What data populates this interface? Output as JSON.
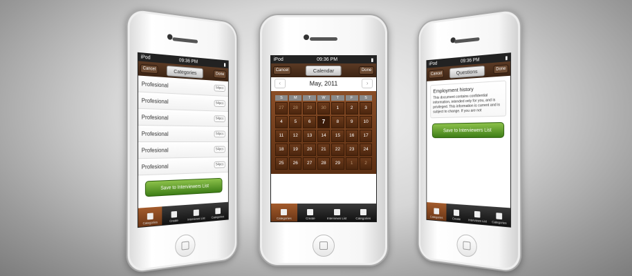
{
  "phones": [
    {
      "status": {
        "carrier": "iPod",
        "time": "09:36 PM"
      },
      "nav": {
        "left": "Cancel",
        "title": "Categories",
        "right": "Done"
      },
      "rows": [
        {
          "label": "Profesional",
          "badge": "54pcs"
        },
        {
          "label": "Profesional",
          "badge": "54pcs"
        },
        {
          "label": "Profesional",
          "badge": "54pcs"
        },
        {
          "label": "Profesional",
          "badge": "54pcs"
        },
        {
          "label": "Profesional",
          "badge": "54pcs"
        },
        {
          "label": "Profesional",
          "badge": "54pcs"
        }
      ],
      "save_label": "Save to Interviewers List",
      "tabs": [
        "Categories",
        "Create",
        "Interviews List",
        "Categories"
      ]
    },
    {
      "status": {
        "carrier": "iPod",
        "time": "09:36 PM"
      },
      "nav": {
        "left": "Cancel",
        "title": "Calendar",
        "right": "Done"
      },
      "month": "May, 2011",
      "weekdays": [
        "S",
        "M",
        "T",
        "W",
        "T",
        "F",
        "S"
      ],
      "days": [
        [
          "27",
          "out"
        ],
        [
          "28",
          "out"
        ],
        [
          "29",
          "out"
        ],
        [
          "30",
          "out"
        ],
        [
          "1",
          ""
        ],
        [
          "2",
          ""
        ],
        [
          "3",
          ""
        ],
        [
          "4",
          ""
        ],
        [
          "5",
          ""
        ],
        [
          "6",
          ""
        ],
        [
          "7",
          "today"
        ],
        [
          "8",
          ""
        ],
        [
          "9",
          ""
        ],
        [
          "10",
          ""
        ],
        [
          "11",
          ""
        ],
        [
          "12",
          ""
        ],
        [
          "13",
          ""
        ],
        [
          "14",
          ""
        ],
        [
          "15",
          ""
        ],
        [
          "16",
          ""
        ],
        [
          "17",
          ""
        ],
        [
          "18",
          ""
        ],
        [
          "19",
          ""
        ],
        [
          "20",
          ""
        ],
        [
          "21",
          ""
        ],
        [
          "22",
          ""
        ],
        [
          "23",
          ""
        ],
        [
          "24",
          ""
        ],
        [
          "25",
          ""
        ],
        [
          "26",
          ""
        ],
        [
          "27",
          ""
        ],
        [
          "28",
          ""
        ],
        [
          "29",
          ""
        ],
        [
          "1",
          "out"
        ],
        [
          "2",
          "out"
        ]
      ],
      "tabs": [
        "Categories",
        "Create",
        "Interviews List",
        "Categories"
      ]
    },
    {
      "status": {
        "carrier": "iPod",
        "time": "09:36 PM"
      },
      "nav": {
        "left": "Cancel",
        "title": "Questions",
        "right": "Done"
      },
      "doc": {
        "title": "Employment history",
        "text": "This document contains confidential information, intended only for you, and is privileged. This information is current and is subject to change. If you are not"
      },
      "save_label": "Save to Interviewers List",
      "tabs": [
        "Categories",
        "Create",
        "Interviews List",
        "Categories"
      ]
    }
  ],
  "colors": {
    "brown": "#5c2f13",
    "green": "#3e7e17",
    "tab_active": "#a35b2c"
  }
}
